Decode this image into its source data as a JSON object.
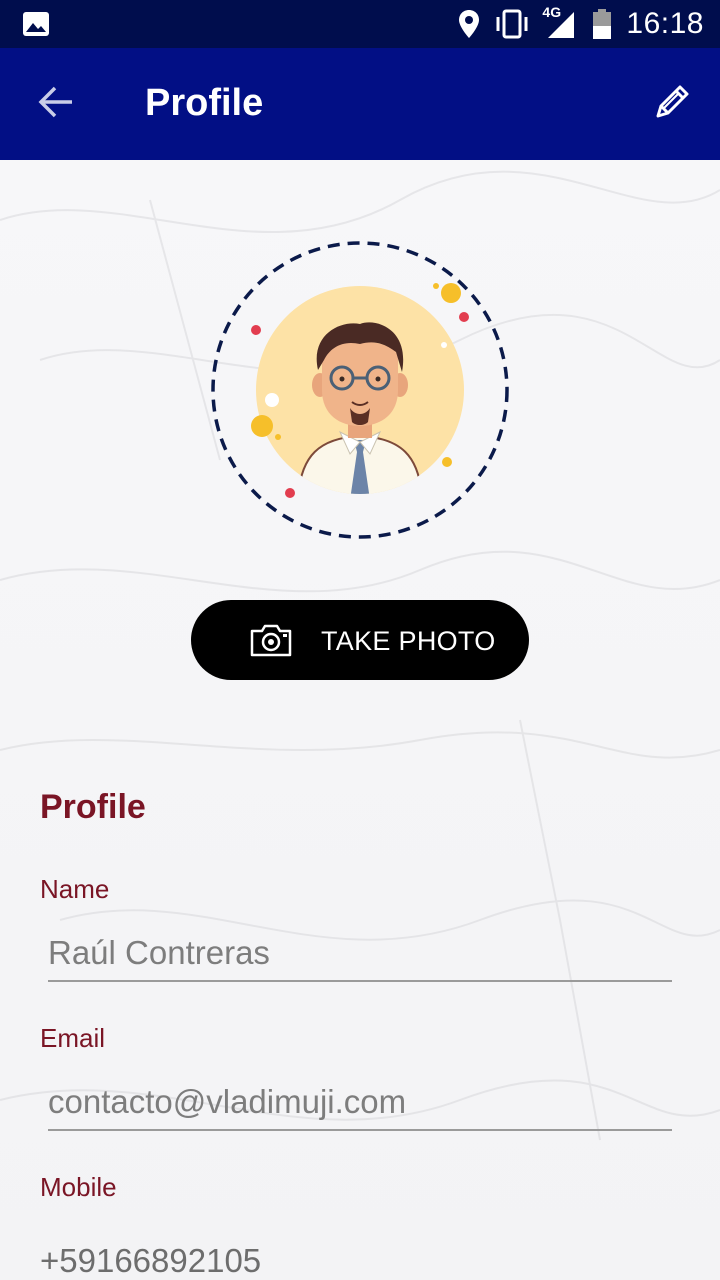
{
  "status_bar": {
    "time": "16:18",
    "network": "4G",
    "icons": [
      "image-icon",
      "location-icon",
      "vibrate-icon",
      "signal-icon",
      "battery-icon"
    ]
  },
  "app_bar": {
    "title": "Profile",
    "back_icon": "arrow-back-icon",
    "edit_icon": "pencil-icon"
  },
  "photo": {
    "button_label": "TAKE PHOTO",
    "button_icon": "camera-icon"
  },
  "profile": {
    "section_title": "Profile",
    "name_label": "Name",
    "name_value": "Raúl Contreras",
    "email_label": "Email",
    "email_value": "contacto@vladimuji.com",
    "mobile_label": "Mobile",
    "mobile_value": "+59166892105"
  },
  "colors": {
    "status_bar": "#000d4d",
    "app_bar": "#020f85",
    "accent_label": "#7a1525",
    "button": "#000000",
    "avatar_ring": "#0b1a4a",
    "avatar_bg": "#fde2a6"
  }
}
